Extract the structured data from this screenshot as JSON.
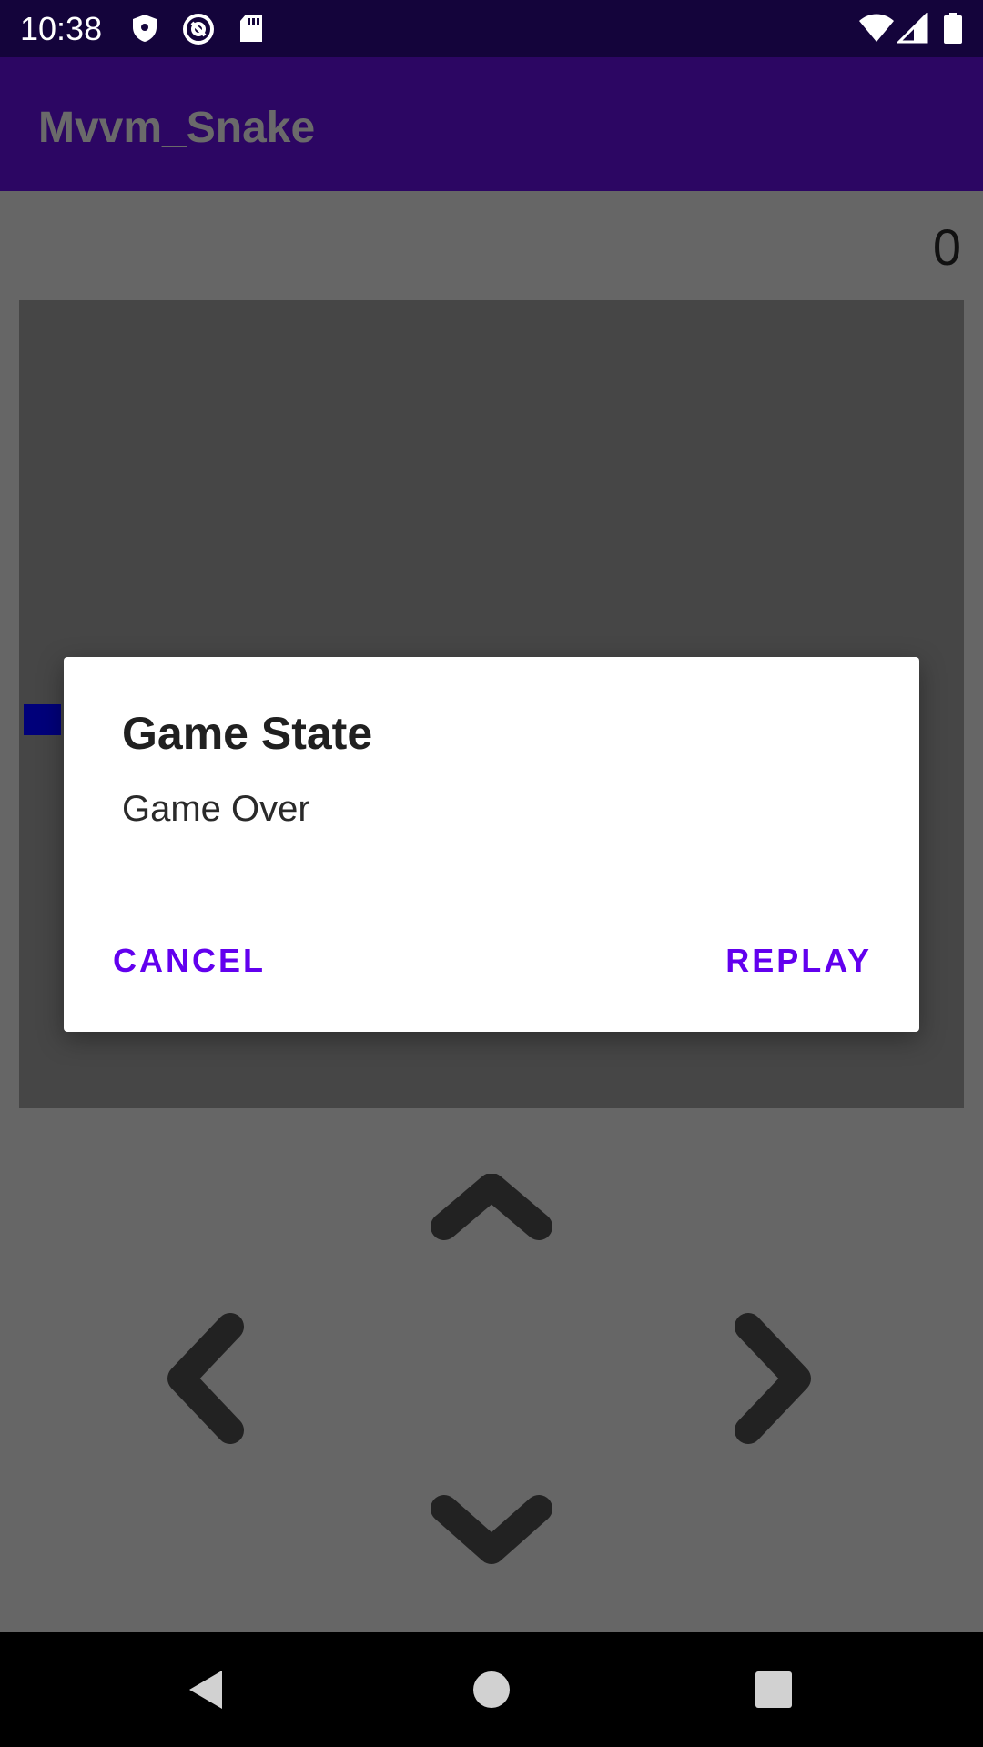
{
  "status_bar": {
    "time": "10:38",
    "icons": [
      "shield-icon",
      "at-sign-icon",
      "sd-card-icon",
      "wifi-icon",
      "cell-signal-icon",
      "battery-icon"
    ]
  },
  "app_bar": {
    "title": "Mvvm_Snake"
  },
  "score": "0",
  "board": {
    "background": "#464646",
    "snake_color": "#00007a"
  },
  "controls": [
    "chevron-up-icon",
    "chevron-left-icon",
    "chevron-right-icon",
    "chevron-down-icon"
  ],
  "dialog": {
    "title": "Game State",
    "message": "Game Over",
    "cancel_label": "CANCEL",
    "replay_label": "REPLAY",
    "accent": "#6200ee"
  },
  "nav_bar": {
    "icons": [
      "back-icon",
      "home-icon",
      "recents-icon"
    ]
  }
}
